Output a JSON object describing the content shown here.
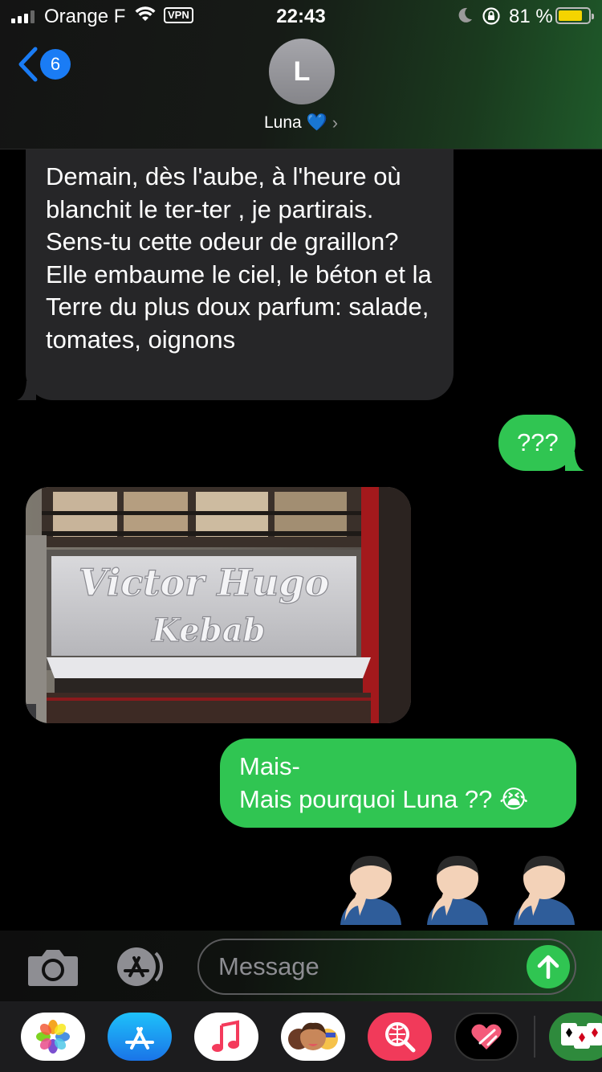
{
  "status_bar": {
    "carrier": "Orange F",
    "vpn": "VPN",
    "time": "22:43",
    "battery_percent": "81 %",
    "battery_level": 0.81,
    "battery_color": "#f5d400"
  },
  "header": {
    "back_count": "6",
    "avatar_initial": "L",
    "contact_name": "Luna 💙",
    "chevron": "›"
  },
  "messages": [
    {
      "direction": "received",
      "type": "text",
      "text": "Demain, dès l'aube, à l'heure où blanchit le ter-ter , je partirais. Sens-tu cette odeur de graillon? Elle embaume le ciel, le béton et la Terre du plus doux parfum: salade, tomates, oignons"
    },
    {
      "direction": "sent",
      "type": "text",
      "text": "???"
    },
    {
      "direction": "received",
      "type": "image",
      "sign_line1": "Victor Hugo",
      "sign_line2": "Kebab"
    },
    {
      "direction": "sent",
      "type": "text",
      "line1": "Mais-",
      "line2": "Mais pourquoi Luna ?? 😭"
    },
    {
      "direction": "sent",
      "type": "emoji",
      "text": "🤦🏻‍♂️🤦🏻‍♂️🤦🏻‍♂️"
    }
  ],
  "composer": {
    "placeholder": "Message",
    "send_icon": "arrow-up-icon"
  },
  "app_drawer": [
    "photos-icon",
    "app-store-icon",
    "music-icon",
    "memoji-icon",
    "web-search-icon",
    "digital-touch-icon",
    "solitaire-icon"
  ],
  "colors": {
    "sent_bubble": "#30c552",
    "received_bubble": "#262628",
    "accent_blue": "#1a7cf5"
  }
}
